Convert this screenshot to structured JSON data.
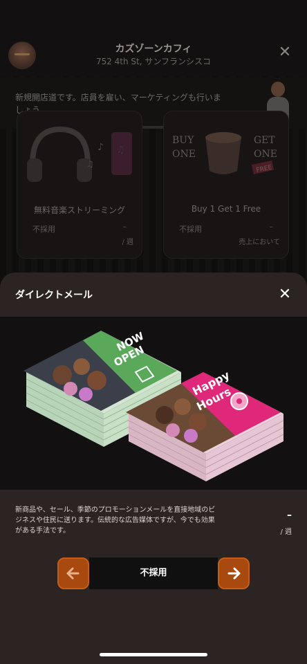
{
  "header": {
    "shop_name": "カズゾーンカフィ",
    "address": "752 4th St, サンフランシスコ"
  },
  "notice": {
    "text": "新規開店道です。店員を雇い、マーケティングも行いましょう。"
  },
  "cards": [
    {
      "title": "無料音楽ストリーミング",
      "status": "不採用",
      "price": "–",
      "note": "/ 週"
    },
    {
      "title": "Buy 1 Get 1 Free",
      "status": "不採用",
      "price": "–",
      "note": "売上において"
    }
  ],
  "card_art_text": {
    "buy_one": [
      "BUY",
      "ONE"
    ],
    "get_one": [
      "GET",
      "ONE"
    ],
    "free": "FREE"
  },
  "sheet": {
    "title": "ダイレクトメール",
    "description": "新商品や、セール、季節のプロモーションメールを直接地域のビジネスや住民に送ります。伝統的な広告媒体ですが、今でも効果がある手法です。",
    "price": "–",
    "unit": "/ 週"
  },
  "selector": {
    "label": "不採用"
  },
  "flyers": {
    "left": [
      "NOW",
      "OPEN"
    ],
    "right": [
      "Happy",
      "Hours"
    ]
  },
  "colors": {
    "accent": "#a84a0f",
    "sheet_bg": "#2b2422",
    "flyer_green": "#5aa85a",
    "flyer_pink": "#e0287a"
  }
}
